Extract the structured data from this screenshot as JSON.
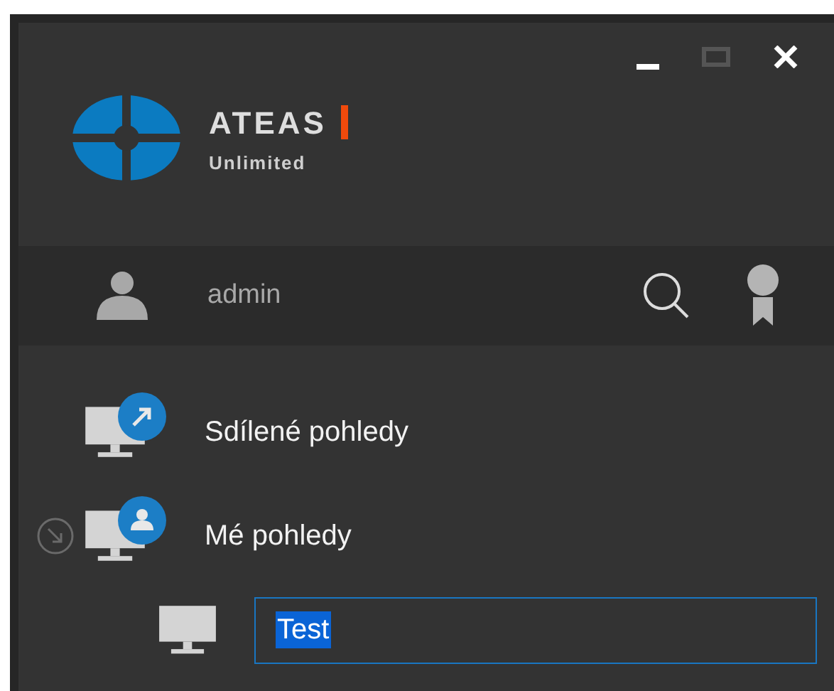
{
  "logo": {
    "name": "ATEAS",
    "tagline": "Unlimited"
  },
  "user": {
    "name": "admin"
  },
  "tree": [
    {
      "label": "Sdílené pohledy",
      "kind": "share",
      "expanded": false
    },
    {
      "label": "Mé pohledy",
      "kind": "user",
      "expanded": true,
      "children": [
        {
          "kind": "edit",
          "value": "Test"
        }
      ]
    }
  ]
}
